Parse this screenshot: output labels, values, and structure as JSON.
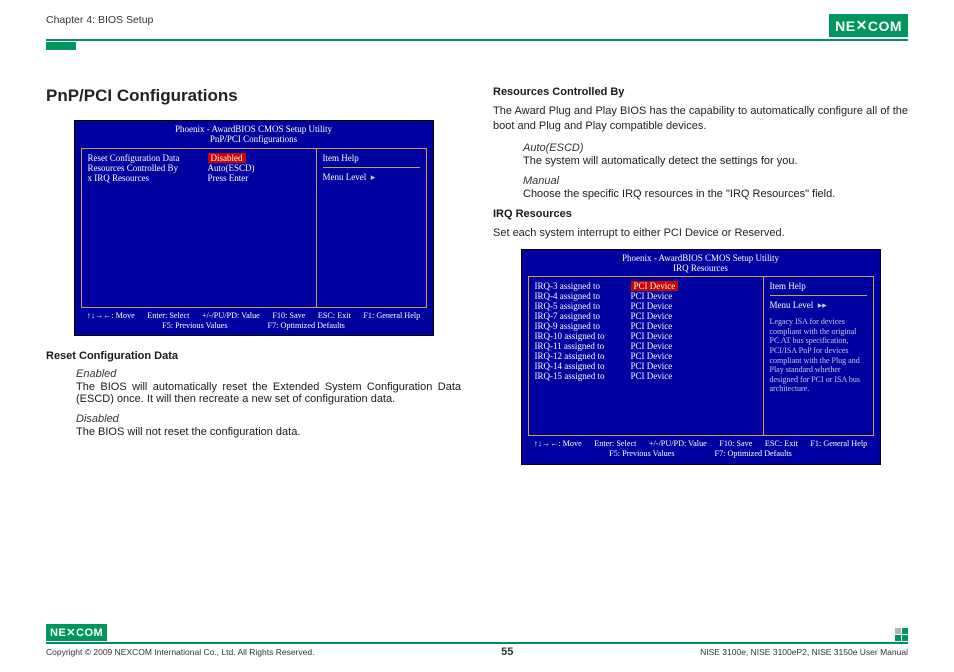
{
  "header": {
    "chapter": "Chapter 4: BIOS Setup",
    "brand_left": "NE",
    "brand_right": "COM"
  },
  "col1": {
    "title": "PnP/PCI Configurations",
    "bios_a": {
      "title_l1": "Phoenix - AwardBIOS CMOS Setup Utility",
      "title_l2": "PnP/PCI Configurations",
      "rows": [
        {
          "lbl": "Reset Configuration Data",
          "val": "Disabled",
          "red": true
        },
        {
          "lbl": "",
          "val": ""
        },
        {
          "lbl": "Resources Controlled By",
          "val": "Auto(ESCD)"
        },
        {
          "lbl": "x  IRQ Resources",
          "val": "Press Enter"
        }
      ],
      "right_title": "Item Help",
      "right_menu": "Menu Level",
      "footer": {
        "r1": [
          "↑↓→←: Move",
          "Enter: Select",
          "+/-/PU/PD: Value",
          "F10: Save",
          "ESC: Exit",
          "F1: General Help"
        ],
        "r2": [
          "F5: Previous Values",
          "F7: Optimized Defaults"
        ]
      }
    },
    "h_reset": "Reset Configuration Data",
    "enabled_term": "Enabled",
    "enabled_desc": "The BIOS will automatically reset the Extended System Configuration Data (ESCD) once. It will then recreate a new set of configuration data.",
    "disabled_term": "Disabled",
    "disabled_desc": "The BIOS will not reset the configuration data."
  },
  "col2": {
    "h_rcb": "Resources Controlled By",
    "rcb_intro": "The Award Plug and Play BIOS has the capability to automatically configure all of the boot and Plug and Play compatible devices.",
    "auto_term": "Auto(ESCD)",
    "auto_desc": "The system will automatically detect the settings for you.",
    "manual_term": "Manual",
    "manual_desc": "Choose the specific IRQ resources in the \"IRQ Resources\" field.",
    "h_irq": "IRQ Resources",
    "irq_intro": "Set each system interrupt to either PCI Device or Reserved.",
    "bios_b": {
      "title_l1": "Phoenix - AwardBIOS CMOS Setup Utility",
      "title_l2": "IRQ Resources",
      "rows": [
        {
          "lbl": "IRQ-3   assigned to",
          "val": "PCI Device",
          "red": true
        },
        {
          "lbl": "IRQ-4   assigned to",
          "val": "PCI Device"
        },
        {
          "lbl": "IRQ-5   assigned to",
          "val": "PCI Device"
        },
        {
          "lbl": "IRQ-7   assigned to",
          "val": "PCI Device"
        },
        {
          "lbl": "IRQ-9   assigned to",
          "val": "PCI Device"
        },
        {
          "lbl": "IRQ-10  assigned to",
          "val": "PCI Device"
        },
        {
          "lbl": "IRQ-11  assigned to",
          "val": "PCI Device"
        },
        {
          "lbl": "IRQ-12  assigned to",
          "val": "PCI Device"
        },
        {
          "lbl": "IRQ-14  assigned to",
          "val": "PCI Device"
        },
        {
          "lbl": "IRQ-15  assigned to",
          "val": "PCI Device"
        }
      ],
      "right_title": "Item Help",
      "right_menu": "Menu Level",
      "right_arrows": "▸▸",
      "right_help": "Legacy ISA for devices compliant with the original PC AT bus specification, PCI/ISA PnP for devices compliant with the Plug and Play standard whether designed for PCI or ISA bus architecture.",
      "footer": {
        "r1": [
          "↑↓→←: Move",
          "Enter: Select",
          "+/-/PU/PD: Value",
          "F10: Save",
          "ESC: Exit",
          "F1: General Help"
        ],
        "r2": [
          "F5: Previous Values",
          "F7: Optimized Defaults"
        ]
      }
    }
  },
  "footer": {
    "copyright": "Copyright © 2009 NEXCOM International Co., Ltd. All Rights Reserved.",
    "page": "55",
    "doc": "NISE 3100e, NISE 3100eP2, NISE 3150e User Manual"
  }
}
